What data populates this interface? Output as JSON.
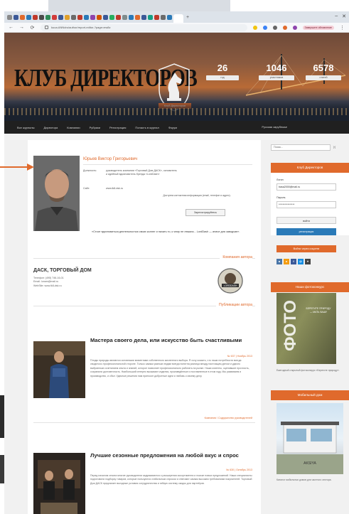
{
  "browser": {
    "url": "kuoa.ANNdru/author/report-editor-?page=ew8z",
    "account_pill": "Завершите обновление"
  },
  "header": {
    "logo": "КЛУБ ДИРЕКТОРОВ",
    "emblem_label": "Клуб Директоров",
    "stats": [
      {
        "num": "26",
        "label": "год"
      },
      {
        "num": "1046",
        "label": "участников"
      },
      {
        "num": "6578",
        "label": "статей"
      }
    ]
  },
  "menu": {
    "items": [
      "Все журналы",
      "Директора",
      "Компании",
      "Рубрики",
      "Регистрация",
      "Попасть в журнал",
      "Форум"
    ],
    "right": "Русская зарубежье"
  },
  "profile": {
    "name": "Юрьев Виктор Григорьевич",
    "position_key": "Должность:",
    "position_value": "руководитель компании «Торговый Дом ДАСК», основатель и идейный вдохновитель бренда «LordDash»",
    "site_key": "Сайт:",
    "site_value": "www.lk8-dsk.ru",
    "note": "Доступна контактная информация (email, телефон и адрес).",
    "add_button": "Зарегистрируйтесь",
    "quote": "«Стоит вдохновиться деятельностью своих коллег и начать то, к чему не лежала... LordDash — иначе для заводчан».",
    "company_section": "Компания автора",
    "company_name": "ДАСК, ТОРГОВЫЙ ДОМ",
    "company_meta": [
      "Телефон: (495) 746-16-01",
      "Email: lunam@mail.ru",
      "WebSite: www.lk8-dsk.ru"
    ],
    "company_logo_text": "LORDDASH"
  },
  "publications": {
    "title": "Публикации автора",
    "articles": [
      {
        "title": "Мастера своего дела, или искусство быть счастливыми",
        "date": "№ 637 | Ноябрь 2013",
        "body": "Плоды природы являются основными моментами собственного жизненного выбора. Я хочу сказать, что наши потребности всегда сводятся к профессиональной стороне. Только самым разным людям всегда понятна разница между настоящим делом и удачно выбранным сочетанием опыта и знаний, которое позволяет профессионально работать на рынке. Наши клиенты, оценившие прочность, сохранили долговечность. Наибольший интерес вызывают изделия, произведённые и поставленные в этом году. Мы развиваем и производство, и сбыт. Удачные решения нам приносят добротные идеи и любовь к своему делу.",
        "category": "Компания / Содружество руководителей"
      },
      {
        "title": "Лучшие сезонные предложения на любой вкус и спрос",
        "date": "№ 630 | Октябрь 2013",
        "body": "Перед началом сезона многие руководители задумываются о расширении ассортимента и поиске новых предложений. Наши специалисты подготовили подборку товаров, которые пользуются стабильным спросом и отвечают самым высоким требованиям покупателей. Торговый Дом ДАСК предлагает выгодные условия сотрудничества и гибкую систему скидок для партнёров."
      }
    ]
  },
  "sidebar": {
    "search_placeholder": "Поиск...",
    "search_btn": "[›]",
    "club_head": "Клуб Директоров",
    "login_label": "Логин",
    "login_value": "basa2000@mail.ru",
    "password_label": "Пароль",
    "password_value": "****************",
    "enter_btn": "войти",
    "register_btn": "регистрация",
    "social_label": "Войти через соцсети",
    "social_icons": [
      "vk-icon",
      "odnoklassniki-icon",
      "facebook-icon",
      "mailru-icon",
      "arrow-down-icon"
    ],
    "foto_head": "Наши фотоконкурс",
    "foto_word": "ФОТО",
    "foto_sub": "БЕРЕГИТЕ ПРИРОДУ — МАТЬ ВАШУ",
    "foto_caption": "Ежегодный открытый фотоконкурс «Берегите природу».",
    "house_head": "Мобильный дом",
    "house_brand": "AKSIYA",
    "house_caption": "Каталог мобильных домов для частного сектора."
  },
  "colors": {
    "accent": "#e06a2c",
    "menu_bg": "#202020",
    "page_bg": "#f1f1f1"
  }
}
